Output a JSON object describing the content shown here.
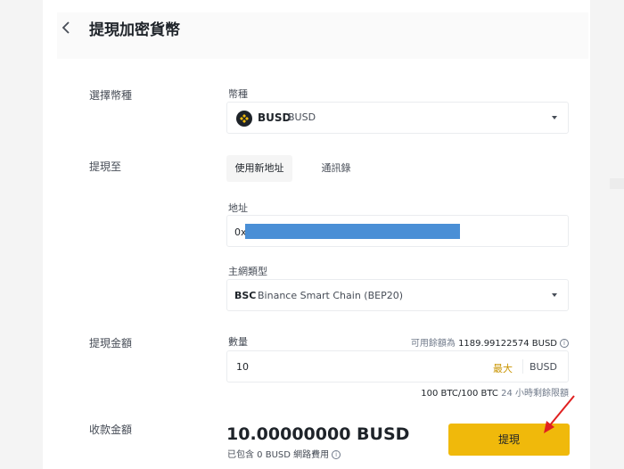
{
  "header": {
    "title": "提現加密貨幣"
  },
  "coin_row": {
    "label": "選擇幣種",
    "field_label": "幣種",
    "symbol": "BUSD",
    "name": "BUSD"
  },
  "withdraw_to": {
    "label": "提現至",
    "tabs": [
      {
        "label": "使用新地址",
        "active": true
      },
      {
        "label": "通訊錄",
        "active": false
      }
    ],
    "address_label": "地址",
    "address_prefix": "0x",
    "network_label": "主網類型",
    "network_code": "BSC",
    "network_name": "Binance Smart Chain (BEP20)"
  },
  "amount_row": {
    "label": "提現金額",
    "field_label": "數量",
    "available_label": "可用餘額為",
    "available_value": "1189.99122574 BUSD",
    "value": "10",
    "max_label": "最大",
    "unit": "BUSD",
    "limit_value": "100 BTC/100 BTC",
    "limit_label": "24 小時剩餘限額"
  },
  "receive_row": {
    "label": "收款金額",
    "amount": "10.00000000 BUSD",
    "fee_note": "已包含 0 BUSD 網路費用"
  },
  "submit": {
    "label": "提現"
  },
  "colors": {
    "accent": "#f0b90b",
    "max_text": "#c99400",
    "redaction": "#4a8fd6",
    "annotation_arrow": "#e02020"
  }
}
